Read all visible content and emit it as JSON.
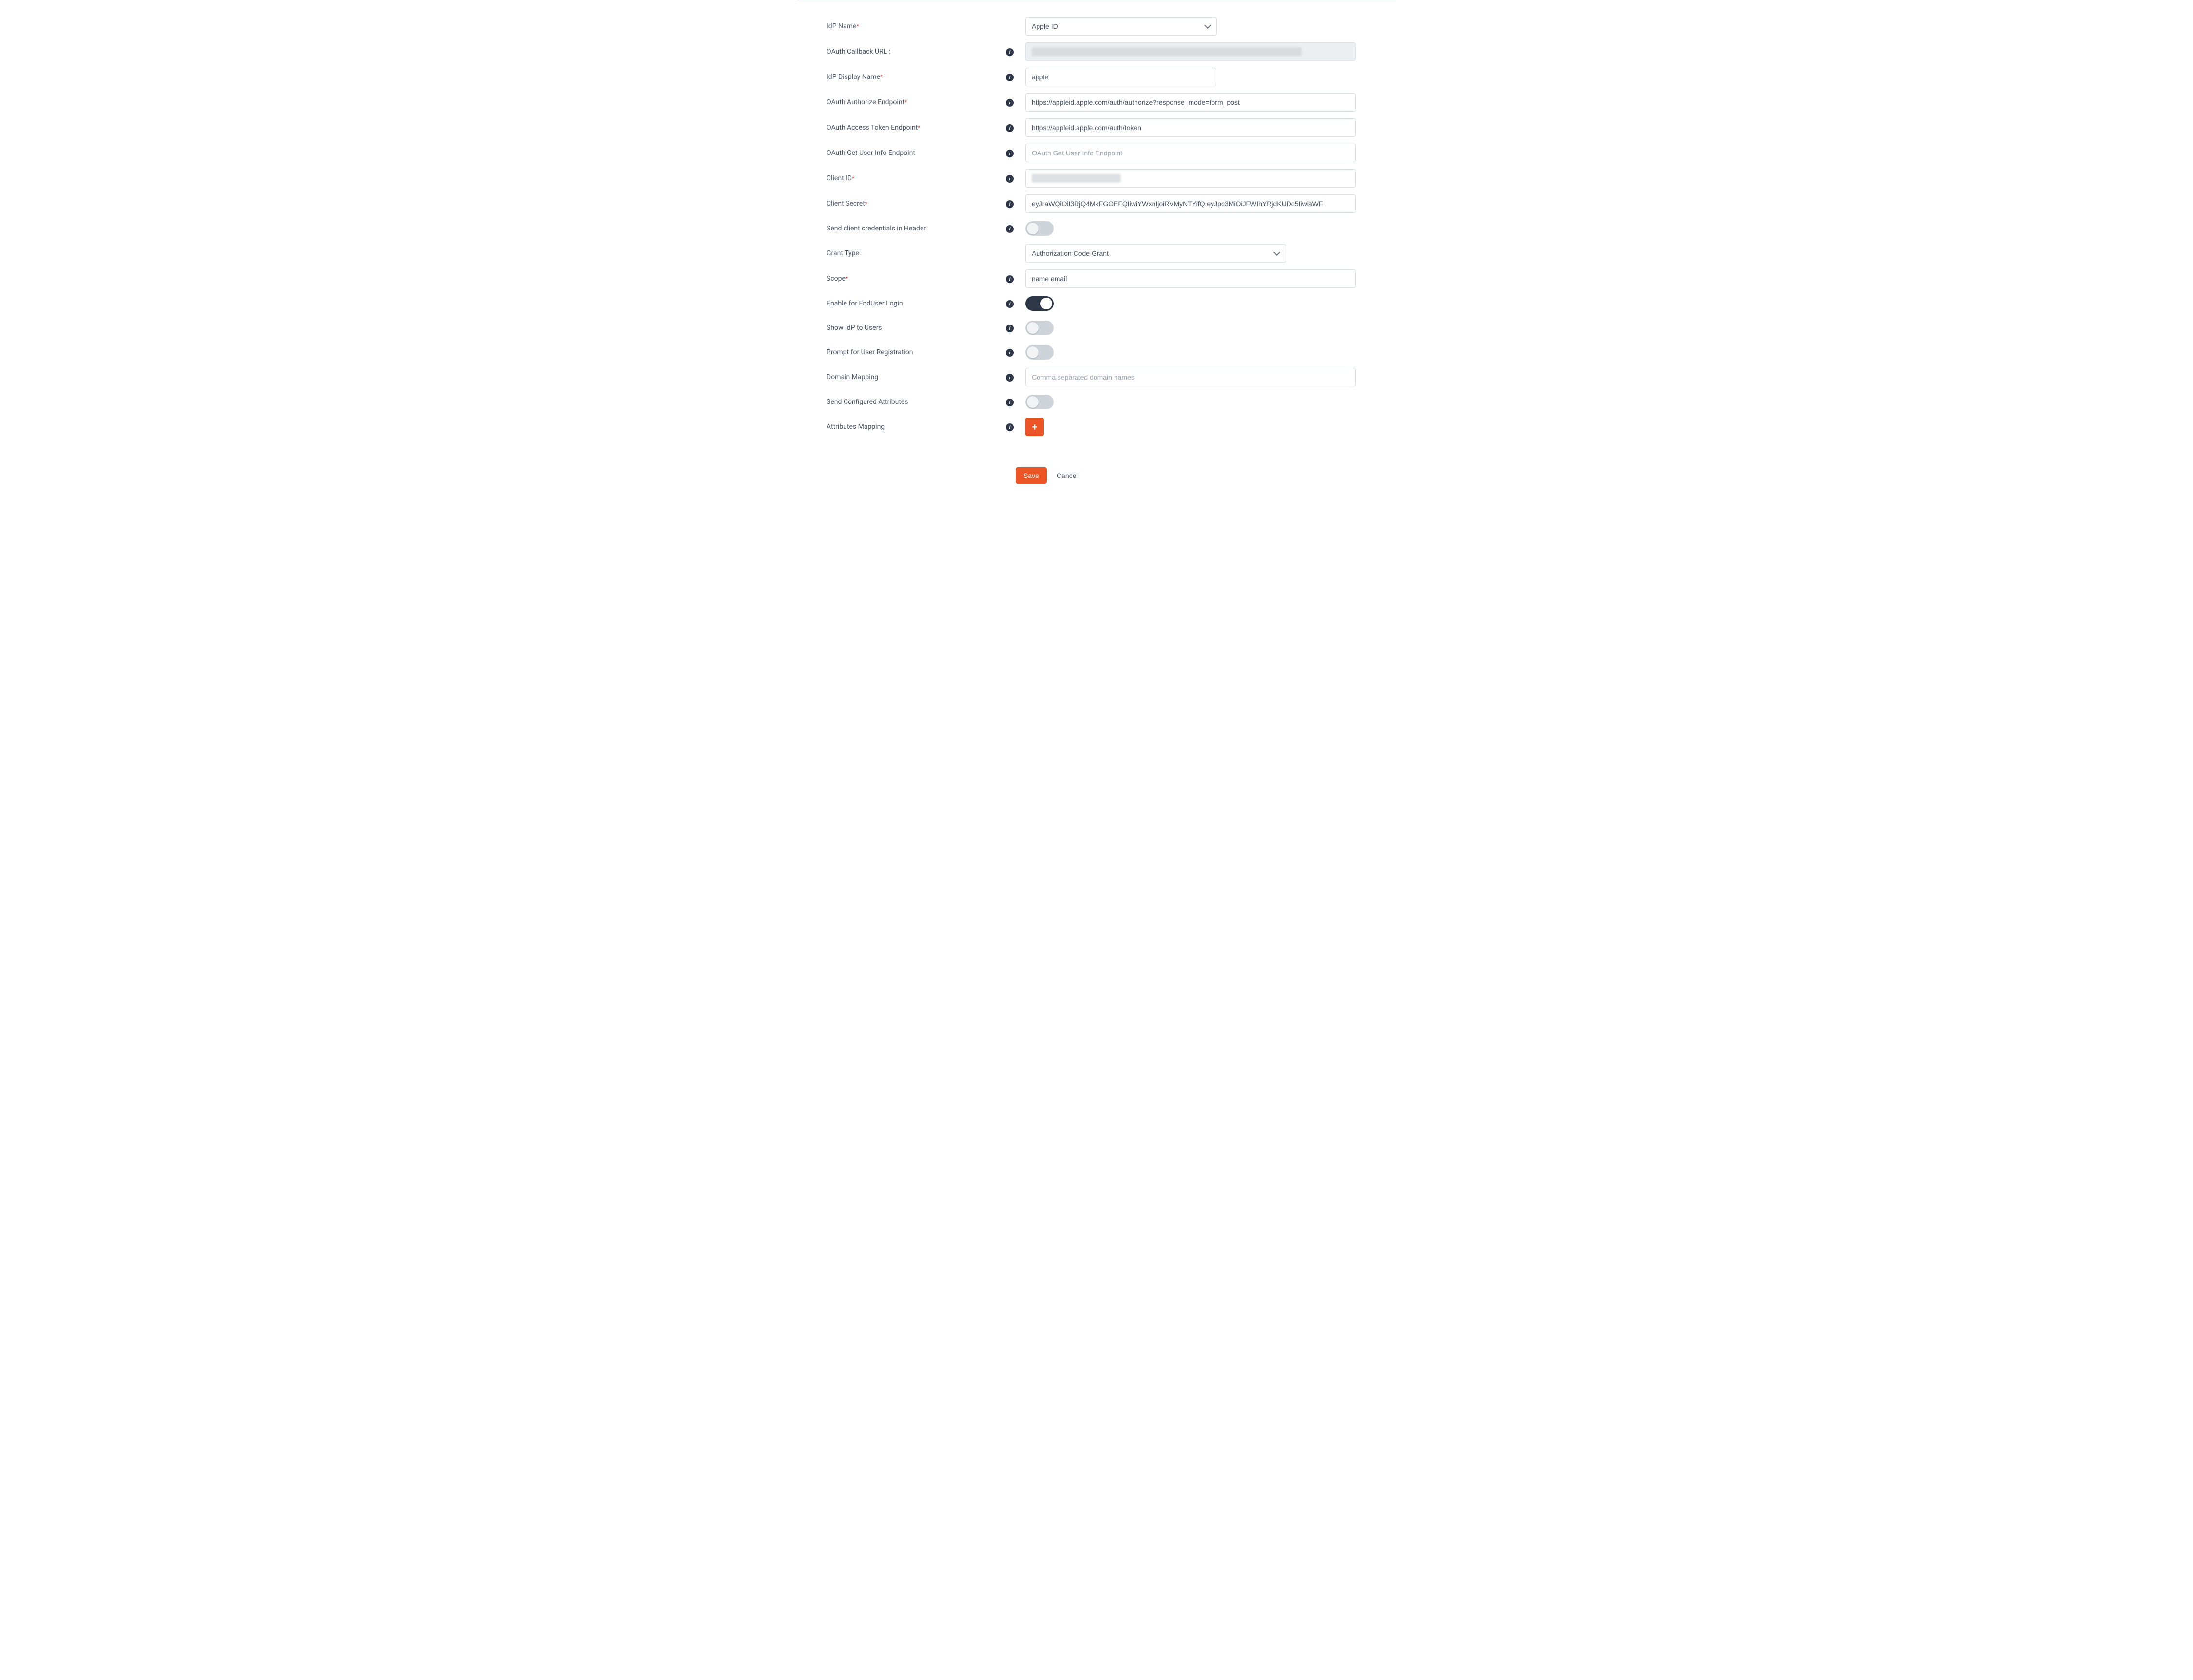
{
  "fields": {
    "idp_name": {
      "label": "IdP Name",
      "required": true,
      "info": false,
      "value": "Apple ID",
      "type": "select-short"
    },
    "callback_url": {
      "label": "OAuth Callback URL :",
      "required": false,
      "info": true,
      "value": "",
      "type": "readonly-blur"
    },
    "display_name": {
      "label": "IdP Display Name",
      "required": true,
      "info": true,
      "value": "apple",
      "type": "text-short"
    },
    "authorize_ep": {
      "label": "OAuth Authorize Endpoint",
      "required": true,
      "info": true,
      "value": "https://appleid.apple.com/auth/authorize?response_mode=form_post",
      "type": "text"
    },
    "token_ep": {
      "label": "OAuth Access Token Endpoint",
      "required": true,
      "info": true,
      "value": "https://appleid.apple.com/auth/token",
      "type": "text"
    },
    "userinfo_ep": {
      "label": "OAuth Get User Info Endpoint",
      "required": false,
      "info": true,
      "placeholder": "OAuth Get User Info Endpoint",
      "value": "",
      "type": "text"
    },
    "client_id": {
      "label": "Client ID",
      "required": true,
      "info": true,
      "value": "",
      "type": "text-blur"
    },
    "client_secret": {
      "label": "Client Secret",
      "required": true,
      "info": true,
      "value": "eyJraWQiOiI3RjQ4MkFGOEFQIiwiYWxnIjoiRVMyNTYifQ.eyJpc3MiOiJFWIhYRjdKUDc5IiwiaWF",
      "type": "text"
    },
    "cred_header": {
      "label": "Send client credentials in Header",
      "required": false,
      "info": true,
      "value": false,
      "type": "toggle"
    },
    "grant_type": {
      "label": "Grant Type:",
      "required": false,
      "info": false,
      "value": "Authorization Code Grant",
      "type": "select-wide"
    },
    "scope": {
      "label": "Scope",
      "required": true,
      "info": true,
      "value": "name email",
      "type": "text"
    },
    "enduser_login": {
      "label": "Enable for EndUser Login",
      "required": false,
      "info": true,
      "value": true,
      "type": "toggle"
    },
    "show_idp": {
      "label": "Show IdP to Users",
      "required": false,
      "info": true,
      "value": false,
      "type": "toggle"
    },
    "prompt_reg": {
      "label": "Prompt for User Registration",
      "required": false,
      "info": true,
      "value": false,
      "type": "toggle"
    },
    "domain_mapping": {
      "label": "Domain Mapping",
      "required": false,
      "info": true,
      "placeholder": "Comma separated domain names",
      "value": "",
      "type": "text"
    },
    "send_attrs": {
      "label": "Send Configured Attributes",
      "required": false,
      "info": true,
      "value": false,
      "type": "toggle"
    },
    "attrs_mapping": {
      "label": "Attributes Mapping",
      "required": false,
      "info": true,
      "value": "",
      "type": "plus"
    }
  },
  "order": [
    "idp_name",
    "callback_url",
    "display_name",
    "authorize_ep",
    "token_ep",
    "userinfo_ep",
    "client_id",
    "client_secret",
    "cred_header",
    "grant_type",
    "scope",
    "enduser_login",
    "show_idp",
    "prompt_reg",
    "domain_mapping",
    "send_attrs",
    "attrs_mapping"
  ],
  "actions": {
    "save": "Save",
    "cancel": "Cancel"
  },
  "icons": {
    "info": "i",
    "plus": "+",
    "required": "*"
  }
}
